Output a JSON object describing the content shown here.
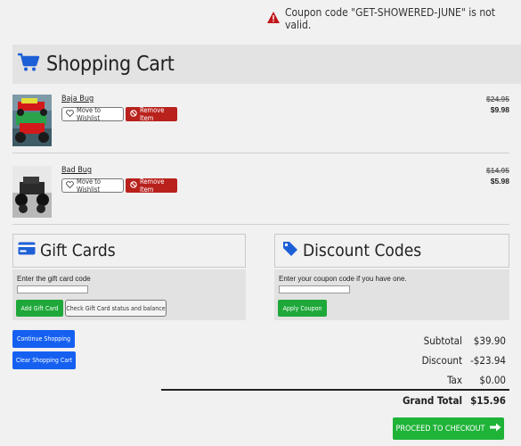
{
  "alert": {
    "icon": "warning-icon",
    "message": "Coupon code \"GET-SHOWERED-JUNE\" is not valid."
  },
  "header": {
    "icon": "cart-icon",
    "title": "Shopping Cart"
  },
  "items": [
    {
      "name": "Baja Bug",
      "wishlist_label": "Move to Wishlist",
      "remove_label": "Remove Item",
      "old_price": "$24.95",
      "price": "$9.98"
    },
    {
      "name": "Bad Bug",
      "wishlist_label": "Move to Wishlist",
      "remove_label": "Remove Item",
      "old_price": "$14.95",
      "price": "$5.98"
    }
  ],
  "gift": {
    "icon": "credit-card-icon",
    "title": "Gift Cards",
    "label": "Enter the gift card code",
    "value": "",
    "add_label": "Add Gift Card",
    "status_label": "Check Gift Card status and balance"
  },
  "discount": {
    "icon": "tag-icon",
    "title": "Discount Codes",
    "label": "Enter your coupon code if you have one.",
    "value": "",
    "apply_label": "Apply Coupon"
  },
  "actions": {
    "continue_label": "Continue Shopping",
    "clear_label": "Clear Shopping Cart"
  },
  "summary": {
    "subtotal_label": "Subtotal",
    "subtotal": "$39.90",
    "discount_label": "Discount",
    "discount": "-$23.94",
    "tax_label": "Tax",
    "tax": "$0.00",
    "grand_label": "Grand Total",
    "grand": "$15.96"
  },
  "checkout": {
    "label": "PROCEED TO CHECKOUT",
    "icon": "arrow-right-icon"
  },
  "colors": {
    "red": "#b8211c",
    "green": "#1fa83a",
    "blue": "#1560f1",
    "icon_blue": "#1d5fd6",
    "alert_red": "#c0161b"
  }
}
